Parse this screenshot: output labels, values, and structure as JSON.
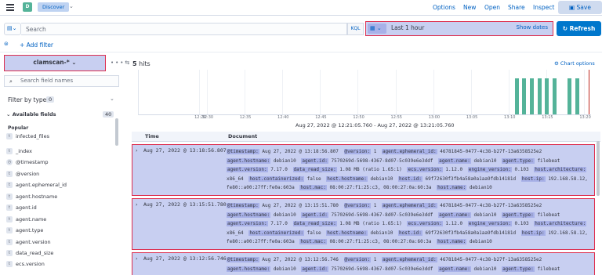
{
  "header": {
    "space_letter": "D",
    "breadcrumb": "Discover",
    "links": [
      "Options",
      "New",
      "Open",
      "Share",
      "Inspect"
    ],
    "save_label": "Save"
  },
  "query": {
    "placeholder": "Search",
    "language": "KQL",
    "time_label": "Last 1 hour",
    "show_dates": "Show dates",
    "refresh": "Refresh"
  },
  "filters": {
    "add_filter": "+ Add filter"
  },
  "sidebar": {
    "index_pattern": "clamscan-*",
    "search_placeholder": "Search field names",
    "filter_by_type": "Filter by type",
    "filter_count": "0",
    "available_fields": "Available fields",
    "available_count": "40",
    "popular": "Popular",
    "fields": [
      {
        "type": "t",
        "name": "infected_files"
      },
      {
        "type": "t",
        "name": "_index"
      },
      {
        "type": "clock",
        "name": "@timestamp"
      },
      {
        "type": "t",
        "name": "@version"
      },
      {
        "type": "t",
        "name": "agent.ephemeral_id"
      },
      {
        "type": "t",
        "name": "agent.hostname"
      },
      {
        "type": "t",
        "name": "agent.id"
      },
      {
        "type": "t",
        "name": "agent.name"
      },
      {
        "type": "t",
        "name": "agent.type"
      },
      {
        "type": "t",
        "name": "agent.version"
      },
      {
        "type": "t",
        "name": "data_read_size"
      },
      {
        "type": "t",
        "name": "ecs.version"
      }
    ]
  },
  "main": {
    "hits_count": "5",
    "hits_label": "hits",
    "chart_options": "Chart options",
    "range_label": "Aug 27, 2022 @ 12:21:05.760 - Aug 27, 2022 @ 13:21:05.760",
    "columns": [
      "Time",
      "Document"
    ]
  },
  "chart_data": {
    "type": "bar",
    "x": [
      "12:29",
      "12:30",
      "12:35",
      "12:40",
      "12:45",
      "12:50",
      "12:55",
      "13:00",
      "13:05",
      "13:10",
      "13:15",
      "13:20"
    ],
    "bar_positions": [
      "13:11",
      "13:12",
      "13:13",
      "13:14",
      "13:15",
      "13:16",
      "13:18",
      "13:19"
    ],
    "values": [
      1,
      1,
      1,
      1,
      1,
      1,
      1,
      1
    ],
    "ylim": [
      0,
      1
    ]
  },
  "docs": [
    {
      "time": "Aug 27, 2022 @ 13:18:56.807",
      "fields": [
        [
          "@timestamp:",
          "Aug 27, 2022 @ 13:18:56.807"
        ],
        [
          "@version:",
          "1"
        ],
        [
          "agent.ephemeral_id:",
          "46781845-0477-4c38-b27f-13a6358525e2"
        ],
        [
          "agent.hostname:",
          "debian10"
        ],
        [
          "agent.id:",
          "7570269d-5698-4367-8d07-5c039e6e3ddf"
        ],
        [
          "agent.name:",
          "debian10"
        ],
        [
          "agent.type:",
          "filebeat"
        ],
        [
          "agent.version:",
          "7.17.0"
        ],
        [
          "data_read_size:",
          "1.08 MB (ratio 1.65:1)"
        ],
        [
          "ecs.version:",
          "1.12.0"
        ],
        [
          "engine_version:",
          "0.103"
        ],
        [
          "host.architecture:",
          "x86_64"
        ],
        [
          "host.containerized:",
          "false"
        ],
        [
          "host.hostname:",
          "debian10"
        ],
        [
          "host.id:",
          "69f72630f3fb4a58a0a1aa9fdb14181d"
        ],
        [
          "host.ip:",
          "192.168.58.12, fe80::a00:27ff:fe0a:603a"
        ],
        [
          "host.mac:",
          "08:00:27:f1:25:c3, 08:00:27:0a:60:3a"
        ],
        [
          "host.name:",
          "debian10"
        ]
      ]
    },
    {
      "time": "Aug 27, 2022 @ 13:15:51.780",
      "fields": [
        [
          "@timestamp:",
          "Aug 27, 2022 @ 13:15:51.780"
        ],
        [
          "@version:",
          "1"
        ],
        [
          "agent.ephemeral_id:",
          "46781845-0477-4c38-b27f-13a6358525e2"
        ],
        [
          "agent.hostname:",
          "debian10"
        ],
        [
          "agent.id:",
          "7570269d-5698-4367-8d07-5c039e6e3ddf"
        ],
        [
          "agent.name:",
          "debian10"
        ],
        [
          "agent.type:",
          "filebeat"
        ],
        [
          "agent.version:",
          "7.17.0"
        ],
        [
          "data_read_size:",
          "1.08 MB (ratio 1.65:1)"
        ],
        [
          "ecs.version:",
          "1.12.0"
        ],
        [
          "engine_version:",
          "0.103"
        ],
        [
          "host.architecture:",
          "x86_64"
        ],
        [
          "host.containerized:",
          "false"
        ],
        [
          "host.hostname:",
          "debian10"
        ],
        [
          "host.id:",
          "69f72630f3fb4a58a0a1aa9fdb14181d"
        ],
        [
          "host.ip:",
          "192.168.58.12, fe80::a00:27ff:fe0a:603a"
        ],
        [
          "host.mac:",
          "08:00:27:f1:25:c3, 08:00:27:0a:60:3a"
        ],
        [
          "host.name:",
          "debian10"
        ]
      ]
    },
    {
      "time": "Aug 27, 2022 @ 13:12:56.746",
      "fields": [
        [
          "@timestamp:",
          "Aug 27, 2022 @ 13:12:56.746"
        ],
        [
          "@version:",
          "1"
        ],
        [
          "agent.ephemeral_id:",
          "46781845-0477-4c38-b27f-13a6358525e2"
        ],
        [
          "agent.hostname:",
          "debian10"
        ],
        [
          "agent.id:",
          "7570269d-5698-4367-8d07-5c039e6e3ddf"
        ],
        [
          "agent.name:",
          "debian10"
        ],
        [
          "agent.type:",
          "filebeat"
        ]
      ]
    }
  ],
  "colors": {
    "accent": "#0077cc",
    "highlight": "#c8cff1",
    "highlight_border": "#dd2e4f",
    "bar": "#54b399"
  }
}
